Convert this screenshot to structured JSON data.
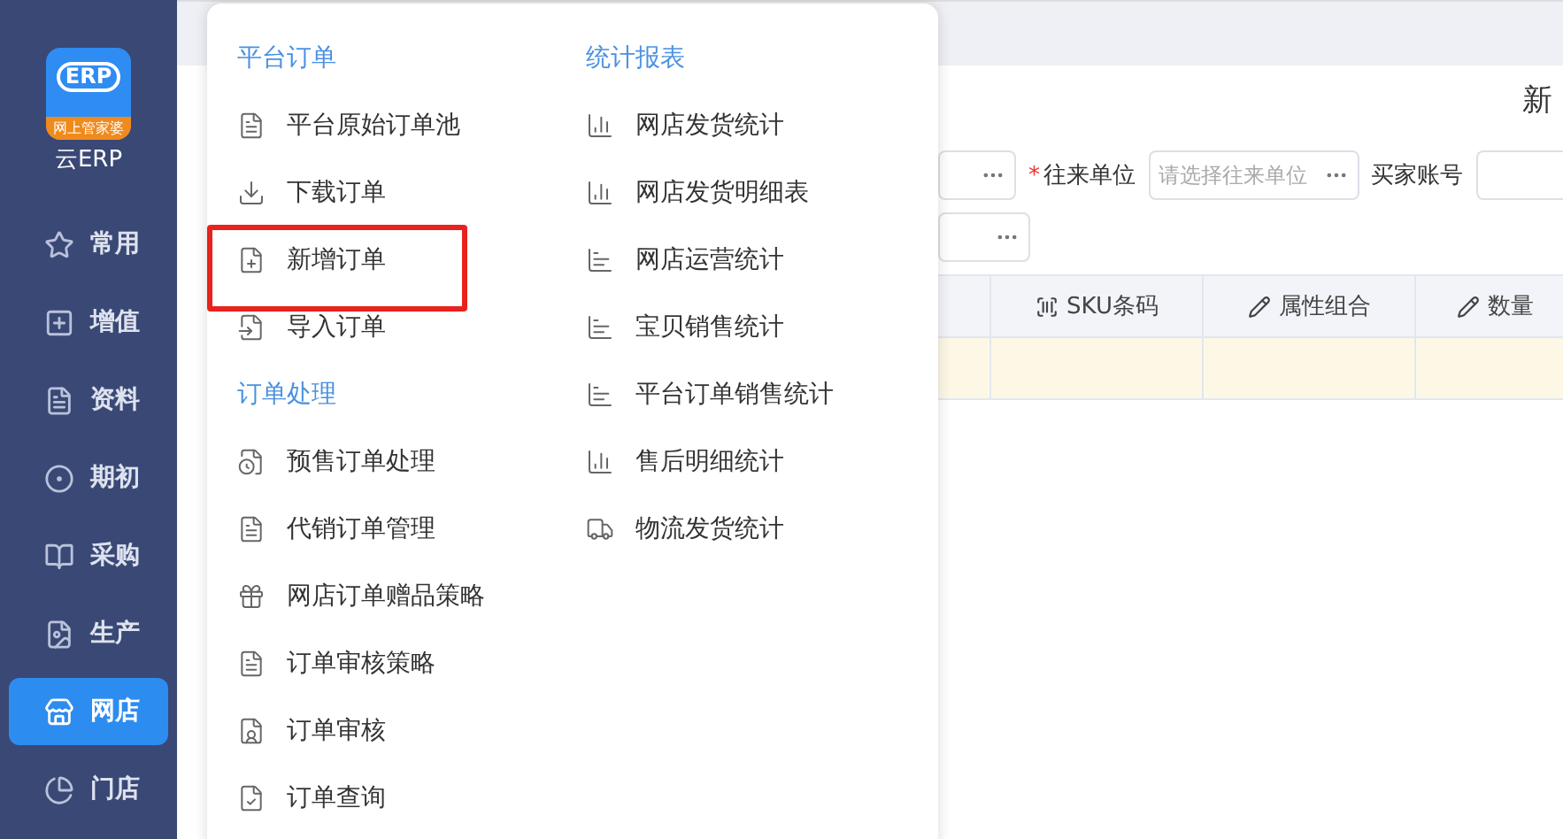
{
  "logo": {
    "badge": "ERP",
    "band": "网上管家婆",
    "name": "云ERP"
  },
  "sidebar": {
    "items": [
      {
        "label": "常用",
        "selected": false
      },
      {
        "label": "增值",
        "selected": false
      },
      {
        "label": "资料",
        "selected": false
      },
      {
        "label": "期初",
        "selected": false
      },
      {
        "label": "采购",
        "selected": false
      },
      {
        "label": "生产",
        "selected": false
      },
      {
        "label": "网店",
        "selected": true
      },
      {
        "label": "门店",
        "selected": false
      }
    ]
  },
  "page": {
    "title": "新",
    "form": {
      "rows": [
        [
          {
            "kind": "field"
          },
          {
            "kind": "label",
            "text": "往来单位",
            "required_mark": "*"
          },
          {
            "kind": "field",
            "placeholder": "请选择往来单位"
          },
          {
            "kind": "label",
            "text": "买家账号"
          },
          {
            "kind": "field"
          }
        ],
        [
          {
            "kind": "field"
          }
        ]
      ]
    },
    "table": {
      "columns": [
        {},
        {
          "label": "SKU条码"
        },
        {
          "label": "属性组合"
        },
        {
          "label": "数量"
        }
      ]
    }
  },
  "flyout": {
    "columns": [
      [
        {
          "kind": "header",
          "label": "平台订单"
        },
        {
          "kind": "item",
          "label": "平台原始订单池",
          "highlighted": false
        },
        {
          "kind": "item",
          "label": "下载订单",
          "highlighted": false
        },
        {
          "kind": "item",
          "label": "新增订单",
          "highlighted": true
        },
        {
          "kind": "item",
          "label": "导入订单",
          "highlighted": false
        },
        {
          "kind": "header",
          "label": "订单处理"
        },
        {
          "kind": "item",
          "label": "预售订单处理",
          "highlighted": false
        },
        {
          "kind": "item",
          "label": "代销订单管理",
          "highlighted": false
        },
        {
          "kind": "item",
          "label": "网店订单赠品策略",
          "highlighted": false
        },
        {
          "kind": "item",
          "label": "订单审核策略",
          "highlighted": false
        },
        {
          "kind": "item",
          "label": "订单审核",
          "highlighted": false
        },
        {
          "kind": "item",
          "label": "订单查询",
          "highlighted": false
        }
      ],
      [
        {
          "kind": "header",
          "label": "统计报表"
        },
        {
          "kind": "item",
          "label": "网店发货统计",
          "highlighted": false
        },
        {
          "kind": "item",
          "label": "网店发货明细表",
          "highlighted": false
        },
        {
          "kind": "item",
          "label": "网店运营统计",
          "highlighted": false
        },
        {
          "kind": "item",
          "label": "宝贝销售统计",
          "highlighted": false
        },
        {
          "kind": "item",
          "label": "平台订单销售统计",
          "highlighted": false
        },
        {
          "kind": "item",
          "label": "售后明细统计",
          "highlighted": false
        },
        {
          "kind": "item",
          "label": "物流发货统计",
          "highlighted": false
        }
      ]
    ]
  }
}
